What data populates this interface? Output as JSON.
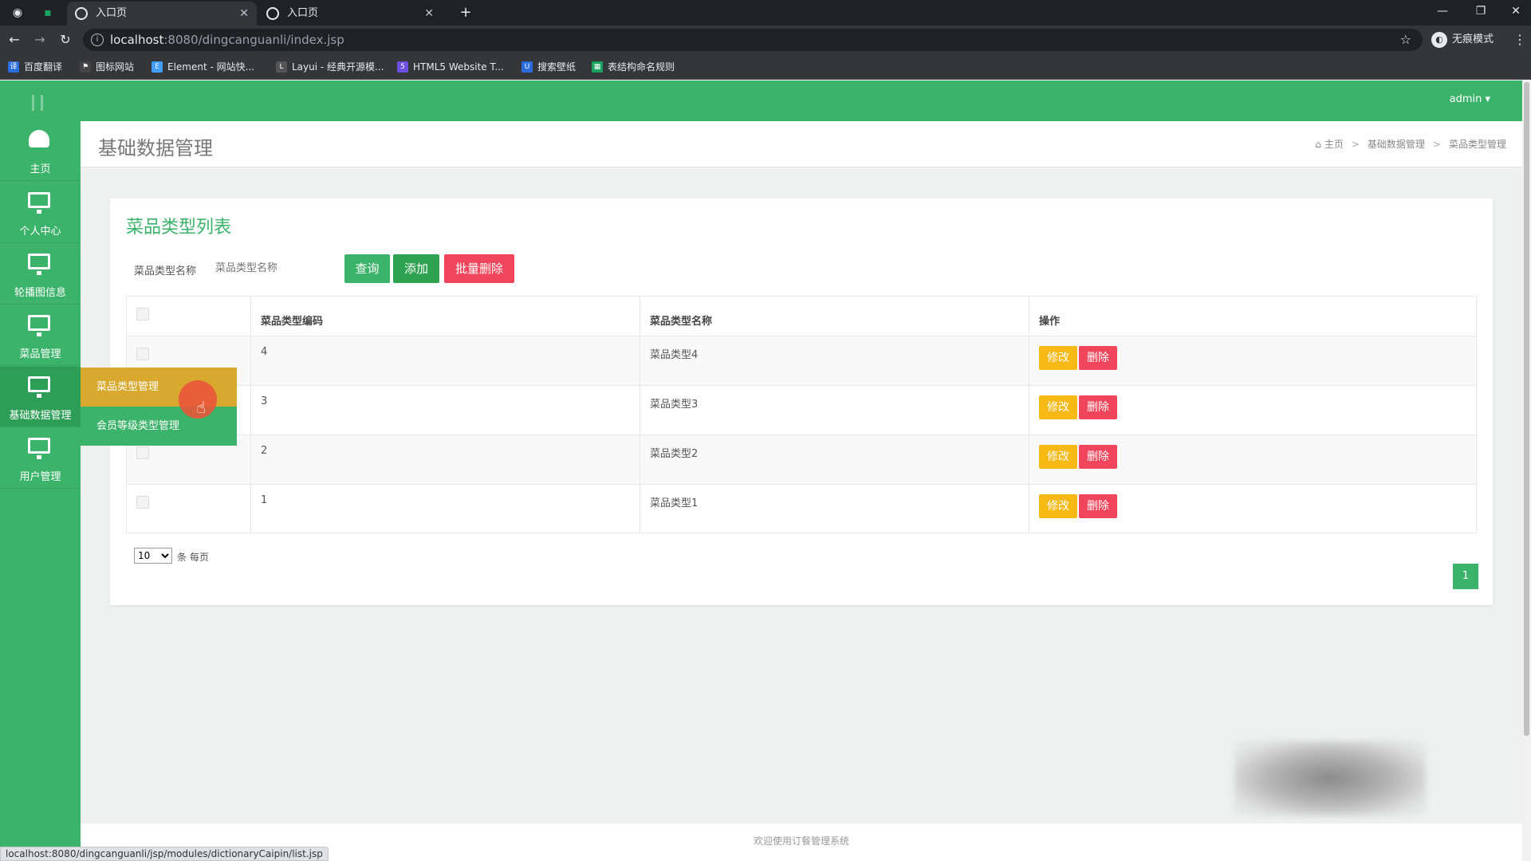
{
  "browser": {
    "tabs": [
      {
        "label": "入口页",
        "active": true
      },
      {
        "label": "入口页",
        "active": false
      }
    ],
    "new_tab": "+",
    "url_host": "localhost",
    "url_path": ":8080/dingcanguanli/index.jsp",
    "incognito_label": "无痕模式",
    "bookmarks": [
      {
        "label": "百度翻译",
        "color": "#2b6cde"
      },
      {
        "label": "图标网站",
        "color": "#444444"
      },
      {
        "label": "Element - 网站快...",
        "color": "#409eff"
      },
      {
        "label": "Layui - 经典开源模...",
        "color": "#555555"
      },
      {
        "label": "HTML5 Website T...",
        "color": "#6c4ee0"
      },
      {
        "label": "搜索壁纸",
        "color": "#2b6cde"
      },
      {
        "label": "表结构命名规则",
        "color": "#1aa260"
      }
    ],
    "status_url": "localhost:8080/dingcanguanli/jsp/modules/dictionaryCaipin/list.jsp"
  },
  "app": {
    "admin_label": "admin ▾",
    "sidebar": [
      {
        "label": "主页",
        "icon": "dashboard-icon"
      },
      {
        "label": "个人中心",
        "icon": "monitor-icon"
      },
      {
        "label": "轮播图信息",
        "icon": "monitor-icon"
      },
      {
        "label": "菜品管理",
        "icon": "monitor-icon"
      },
      {
        "label": "基础数据管理",
        "icon": "monitor-icon"
      },
      {
        "label": "用户管理",
        "icon": "monitor-icon"
      }
    ],
    "submenu": [
      "菜品类型管理",
      "会员等级类型管理"
    ],
    "page_title": "基础数据管理",
    "breadcrumb": [
      "主页",
      "基础数据管理",
      "菜品类型管理"
    ],
    "panel_title": "菜品类型列表",
    "search": {
      "label": "菜品类型名称",
      "placeholder": "菜品类型名称"
    },
    "buttons": {
      "query": "查询",
      "add": "添加",
      "batch_delete": "批量删除",
      "edit": "修改",
      "delete": "删除"
    },
    "table": {
      "headers": [
        "菜品类型编码",
        "菜品类型名称",
        "操作"
      ],
      "rows": [
        {
          "code": "4",
          "name": "菜品类型4"
        },
        {
          "code": "3",
          "name": "菜品类型3"
        },
        {
          "code": "2",
          "name": "菜品类型2"
        },
        {
          "code": "1",
          "name": "菜品类型1"
        }
      ]
    },
    "pagination": {
      "page_size": "10",
      "page_size_label": "条 每页",
      "current_page": "1"
    },
    "footer": "欢迎使用订餐管理系统"
  }
}
